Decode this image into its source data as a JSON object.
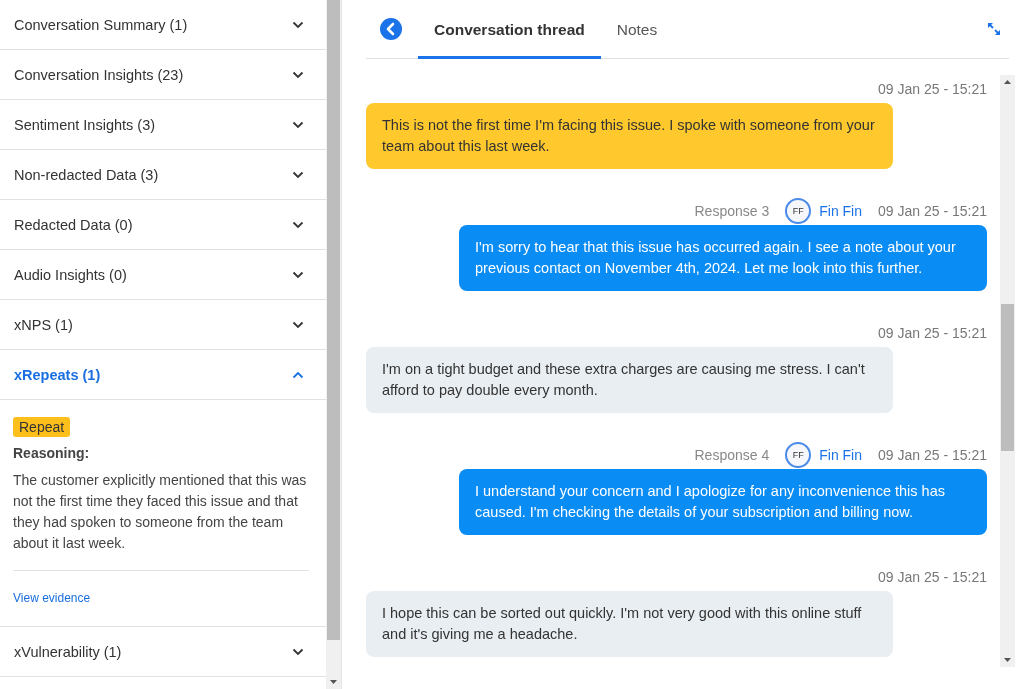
{
  "sidebar": {
    "sections": [
      {
        "title": "Conversation Summary (1)",
        "expanded": false
      },
      {
        "title": "Conversation Insights (23)",
        "expanded": false
      },
      {
        "title": "Sentiment Insights (3)",
        "expanded": false
      },
      {
        "title": "Non-redacted Data (3)",
        "expanded": false
      },
      {
        "title": "Redacted Data (0)",
        "expanded": false
      },
      {
        "title": "Audio Insights (0)",
        "expanded": false
      },
      {
        "title": "xNPS (1)",
        "expanded": false
      },
      {
        "title": "xRepeats (1)",
        "expanded": true,
        "content": {
          "tag": "Repeat",
          "reasoning_label": "Reasoning:",
          "reasoning": "The customer explicitly mentioned that this was not the first time they faced this issue and that they had spoken to someone from the team about it last week.",
          "link": "View evidence"
        }
      },
      {
        "title": "xVulnerability (1)",
        "expanded": false
      }
    ]
  },
  "tabs": [
    {
      "label": "Conversation thread",
      "selected": true
    },
    {
      "label": "Notes",
      "selected": false
    }
  ],
  "messages": [
    {
      "kind": "customer",
      "highlighted": true,
      "timestamp": "09 Jan 25 - 15:21",
      "text": "This is not the first time I'm facing this issue. I spoke with someone from your team about this last week."
    },
    {
      "kind": "agent",
      "response": "Response 3",
      "initials": "FF",
      "agent": "Fin Fin",
      "timestamp": "09 Jan 25 - 15:21",
      "text": "I'm sorry to hear that this issue has occurred again. I see a note about your previous contact on November 4th, 2024. Let me look into this further."
    },
    {
      "kind": "customer",
      "highlighted": false,
      "timestamp": "09 Jan 25 - 15:21",
      "text": "I'm on a tight budget and these extra charges are causing me stress. I can't afford to pay double every month."
    },
    {
      "kind": "agent",
      "response": "Response 4",
      "initials": "FF",
      "agent": "Fin Fin",
      "timestamp": "09 Jan 25 - 15:21",
      "text": "I understand your concern and I apologize for any inconvenience this has caused. I'm checking the details of your subscription and billing now."
    },
    {
      "kind": "customer",
      "highlighted": false,
      "timestamp": "09 Jan 25 - 15:21",
      "text": "I hope this can be sorted out quickly. I'm not very good with this online stuff and it's giving me a headache."
    }
  ]
}
